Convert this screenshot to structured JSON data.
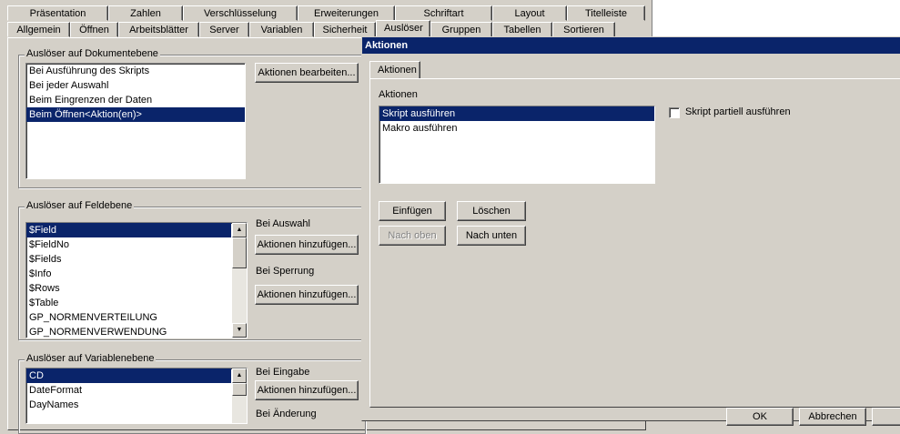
{
  "tabs_row1": [
    "Präsentation",
    "Zahlen",
    "Verschlüsselung",
    "Erweiterungen",
    "Schriftart",
    "Layout",
    "Titelleiste"
  ],
  "tabs_row2": [
    "Allgemein",
    "Öffnen",
    "Arbeitsblätter",
    "Server",
    "Variablen",
    "Sicherheit",
    "Auslöser",
    "Gruppen",
    "Tabellen",
    "Sortieren"
  ],
  "active_tab": "Auslöser",
  "doc_group": {
    "title": "Auslöser auf Dokumentebene",
    "items": [
      "Bei Ausführung des Skripts",
      "Bei jeder Auswahl",
      "Beim Eingrenzen der Daten",
      "Beim Öffnen<Aktion(en)>"
    ],
    "selected_index": 3,
    "edit_button": "Aktionen bearbeiten..."
  },
  "field_group": {
    "title": "Auslöser auf Feldebene",
    "items": [
      "$Field",
      "$FieldNo",
      "$Fields",
      "$Info",
      "$Rows",
      "$Table",
      "GP_NORMENVERTEILUNG",
      "GP_NORMENVERWENDUNG"
    ],
    "selected_index": 0,
    "on_select_label": "Bei Auswahl",
    "on_select_button": "Aktionen hinzufügen...",
    "on_lock_label": "Bei Sperrung",
    "on_lock_button": "Aktionen hinzufügen..."
  },
  "var_group": {
    "title": "Auslöser auf Variablenebene",
    "items": [
      "CD",
      "DateFormat",
      "DayNames"
    ],
    "selected_index": 0,
    "on_input_label": "Bei Eingabe",
    "on_input_button": "Aktionen hinzufügen...",
    "on_change_label": "Bei Änderung"
  },
  "dialog": {
    "title": "Aktionen",
    "tab": "Aktionen",
    "list_label": "Aktionen",
    "items": [
      "Skript ausführen",
      "Makro ausführen"
    ],
    "selected_index": 0,
    "checkbox_label": "Skript partiell ausführen",
    "checkbox_checked": false,
    "insert_button": "Einfügen",
    "delete_button": "Löschen",
    "up_button": "Nach oben",
    "down_button": "Nach unten",
    "ok_button": "OK",
    "cancel_button": "Abbrechen"
  },
  "colors": {
    "face": "#d4d0c8",
    "selection": "#0a246a",
    "title_bar": "#0a246a"
  }
}
